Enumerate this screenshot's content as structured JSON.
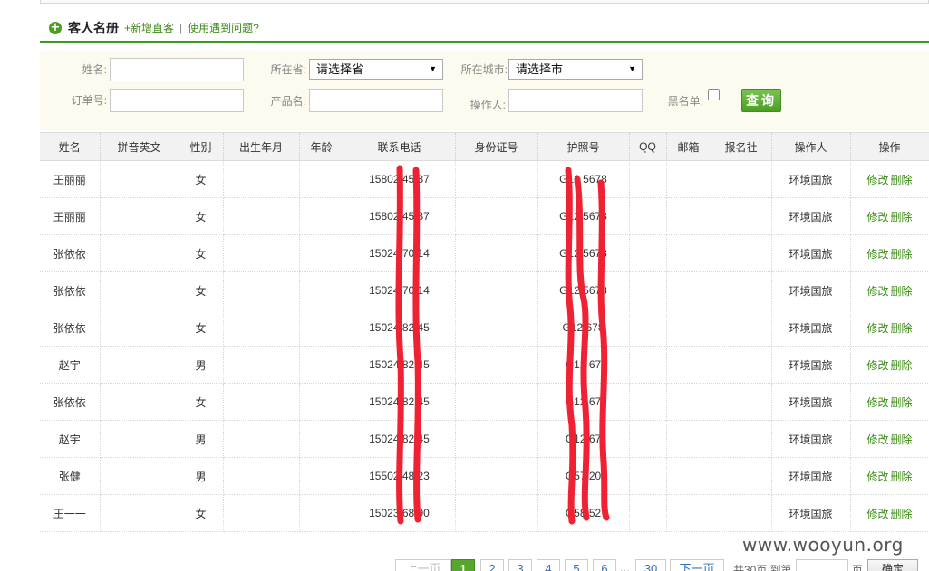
{
  "header": {
    "title": "客人名册",
    "add_link": "+新增直客",
    "separator": "|",
    "help_link": "使用遇到问题?"
  },
  "search": {
    "name_label": "姓名:",
    "province_label": "所在省:",
    "province_value": "请选择省",
    "city_label": "所在城市:",
    "city_value": "请选择市",
    "order_label": "订单号:",
    "product_label": "产品名:",
    "operator_label": "操作人:",
    "blacklist_label": "黑名单:",
    "query_button": "查询"
  },
  "table": {
    "columns": [
      "姓名",
      "拼音英文",
      "性别",
      "出生年月",
      "年龄",
      "联系电话",
      "身份证号",
      "护照号",
      "QQ",
      "邮箱",
      "报名社",
      "操作人",
      "操作"
    ],
    "rows": [
      {
        "name": "王丽丽",
        "gender": "女",
        "phone": "15802 45 87",
        "passport": "G12 5678",
        "operator": "环境国旅"
      },
      {
        "name": "王丽丽",
        "gender": "女",
        "phone": "15802 45 87",
        "passport": "G12 5678",
        "operator": "环境国旅"
      },
      {
        "name": "张依依",
        "gender": "女",
        "phone": "15024 70 14",
        "passport": "G12 5678",
        "operator": "环境国旅"
      },
      {
        "name": "张依依",
        "gender": "女",
        "phone": "15024 70 14",
        "passport": "G12 5678",
        "operator": "环境国旅"
      },
      {
        "name": "张依依",
        "gender": "女",
        "phone": "15024 82 45",
        "passport": "G12 678",
        "operator": "环境国旅"
      },
      {
        "name": "赵宇",
        "gender": "男",
        "phone": "15024 82 45",
        "passport": "G12 67",
        "operator": "环境国旅"
      },
      {
        "name": "张依依",
        "gender": "女",
        "phone": "15024 82 45",
        "passport": "G12 67",
        "operator": "环境国旅"
      },
      {
        "name": "赵宇",
        "gender": "男",
        "phone": "15024 82 45",
        "passport": "G12 67",
        "operator": "环境国旅"
      },
      {
        "name": "张健",
        "gender": "男",
        "phone": "15502 48 23",
        "passport": "G57 20",
        "operator": "环境国旅"
      },
      {
        "name": "王一一",
        "gender": "女",
        "phone": "15023 68 90",
        "passport": "G58 52",
        "operator": "环境国旅"
      }
    ],
    "edit_label": "修改",
    "delete_label": "删除"
  },
  "pagination": {
    "prev": "上一页",
    "pages": [
      "1",
      "2",
      "3",
      "4",
      "5",
      "6"
    ],
    "ellipsis": "...",
    "last_page": "30",
    "next": "下一页",
    "total": "共30页 到第",
    "page_suffix": "页",
    "confirm": "确定"
  },
  "watermark": "www.wooyun.org",
  "colors": {
    "accent_green": "#3a8b12",
    "header_rule": "#3c9a1c",
    "redaction": "#ee2233",
    "panel_bg": "#fdfbef"
  }
}
